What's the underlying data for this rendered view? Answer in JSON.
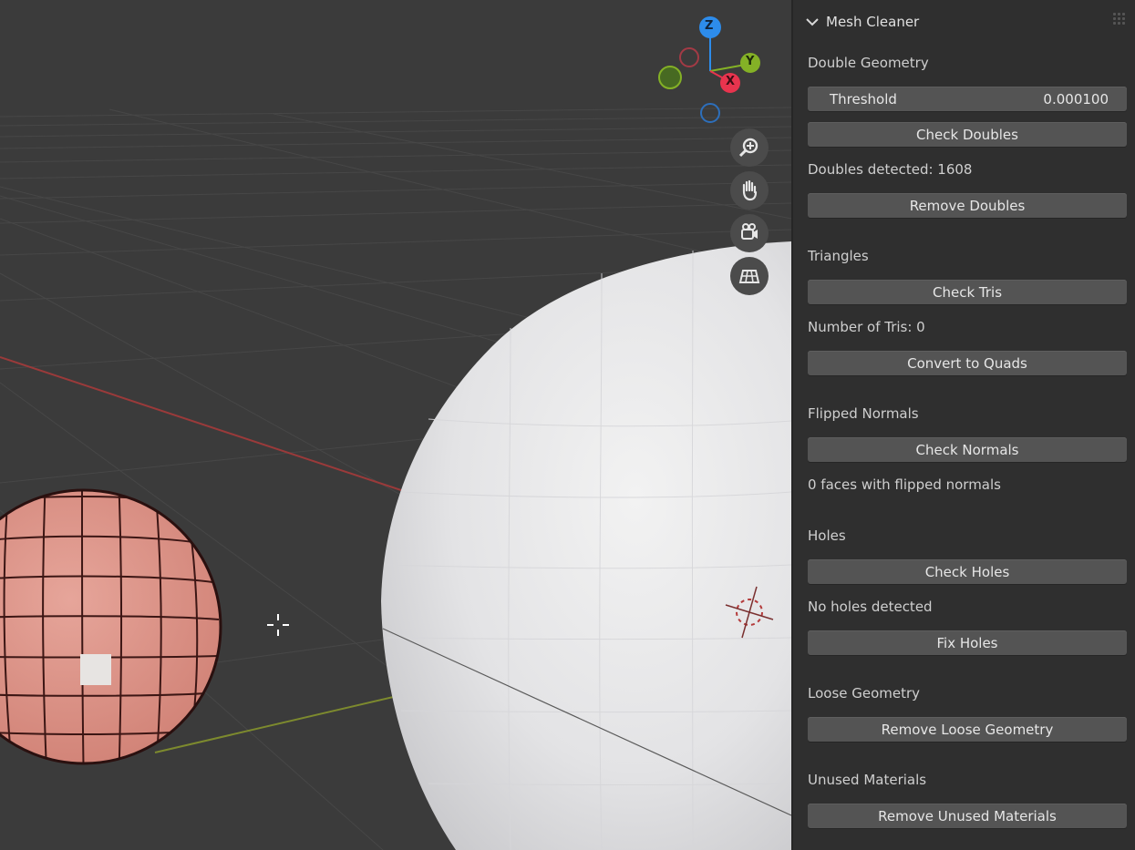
{
  "viewport": {
    "gizmo": {
      "z_label": "Z",
      "y_label": "Y",
      "x_label": "X",
      "colors": {
        "x": "#e8344e",
        "y": "#84b126",
        "z": "#2d8ceb"
      }
    },
    "nav_buttons": [
      "zoom-icon",
      "pan-hand-icon",
      "camera-icon",
      "grid-view-icon"
    ]
  },
  "sidebar": {
    "title": "Mesh Cleaner",
    "double_geometry": {
      "heading": "Double Geometry",
      "threshold_label": "Threshold",
      "threshold_value": "0.000100",
      "check_button": "Check Doubles",
      "status": "Doubles detected: 1608",
      "remove_button": "Remove Doubles"
    },
    "triangles": {
      "heading": "Triangles",
      "check_button": "Check Tris",
      "status": "Number of Tris: 0",
      "convert_button": "Convert to Quads"
    },
    "flipped_normals": {
      "heading": "Flipped Normals",
      "check_button": "Check Normals",
      "status": "0 faces with flipped normals"
    },
    "holes": {
      "heading": "Holes",
      "check_button": "Check Holes",
      "status": "No holes detected",
      "fix_button": "Fix Holes"
    },
    "loose_geometry": {
      "heading": "Loose Geometry",
      "remove_button": "Remove Loose Geometry"
    },
    "unused_materials": {
      "heading": "Unused Materials",
      "remove_button": "Remove Unused Materials"
    }
  }
}
